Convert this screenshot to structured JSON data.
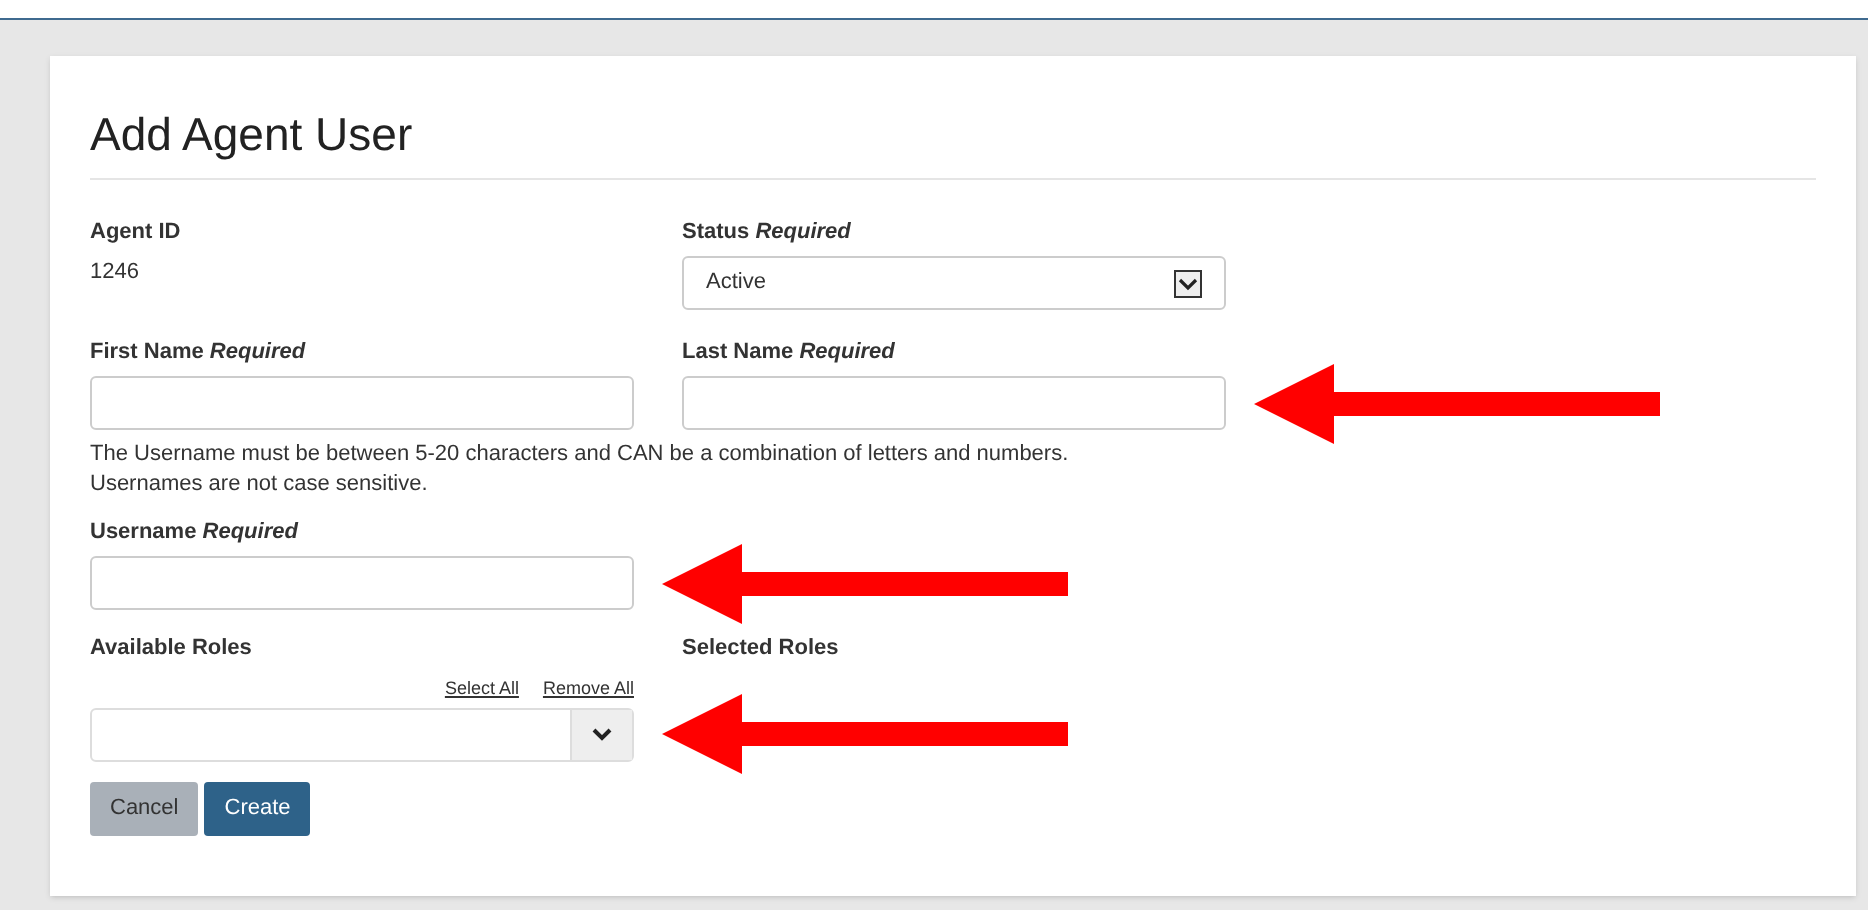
{
  "title": "Add Agent User",
  "agent_id": {
    "label": "Agent ID",
    "value": "1246"
  },
  "status": {
    "label": "Status *Required*",
    "value": "Active"
  },
  "first_name": {
    "label": "First Name *Required*",
    "arrow": false
  },
  "last_name": {
    "label": "Last Name *Required*",
    "arrow": true
  },
  "hint": [
    "The Username must be between 5-20 characters and CAN be a combination of letters and numbers.",
    "Usernames are not case sensitive."
  ],
  "username": {
    "label": "Username *Required*",
    "arrow": true
  },
  "available_roles": {
    "label": "Available Roles",
    "links": [
      "Select All",
      "Remove All"
    ],
    "arrow": true
  },
  "selected_roles": {
    "label": "Selected Roles"
  },
  "buttons": [
    {
      "label": "Cancel",
      "kind": "secondary"
    },
    {
      "label": "Create",
      "kind": "primary"
    }
  ]
}
